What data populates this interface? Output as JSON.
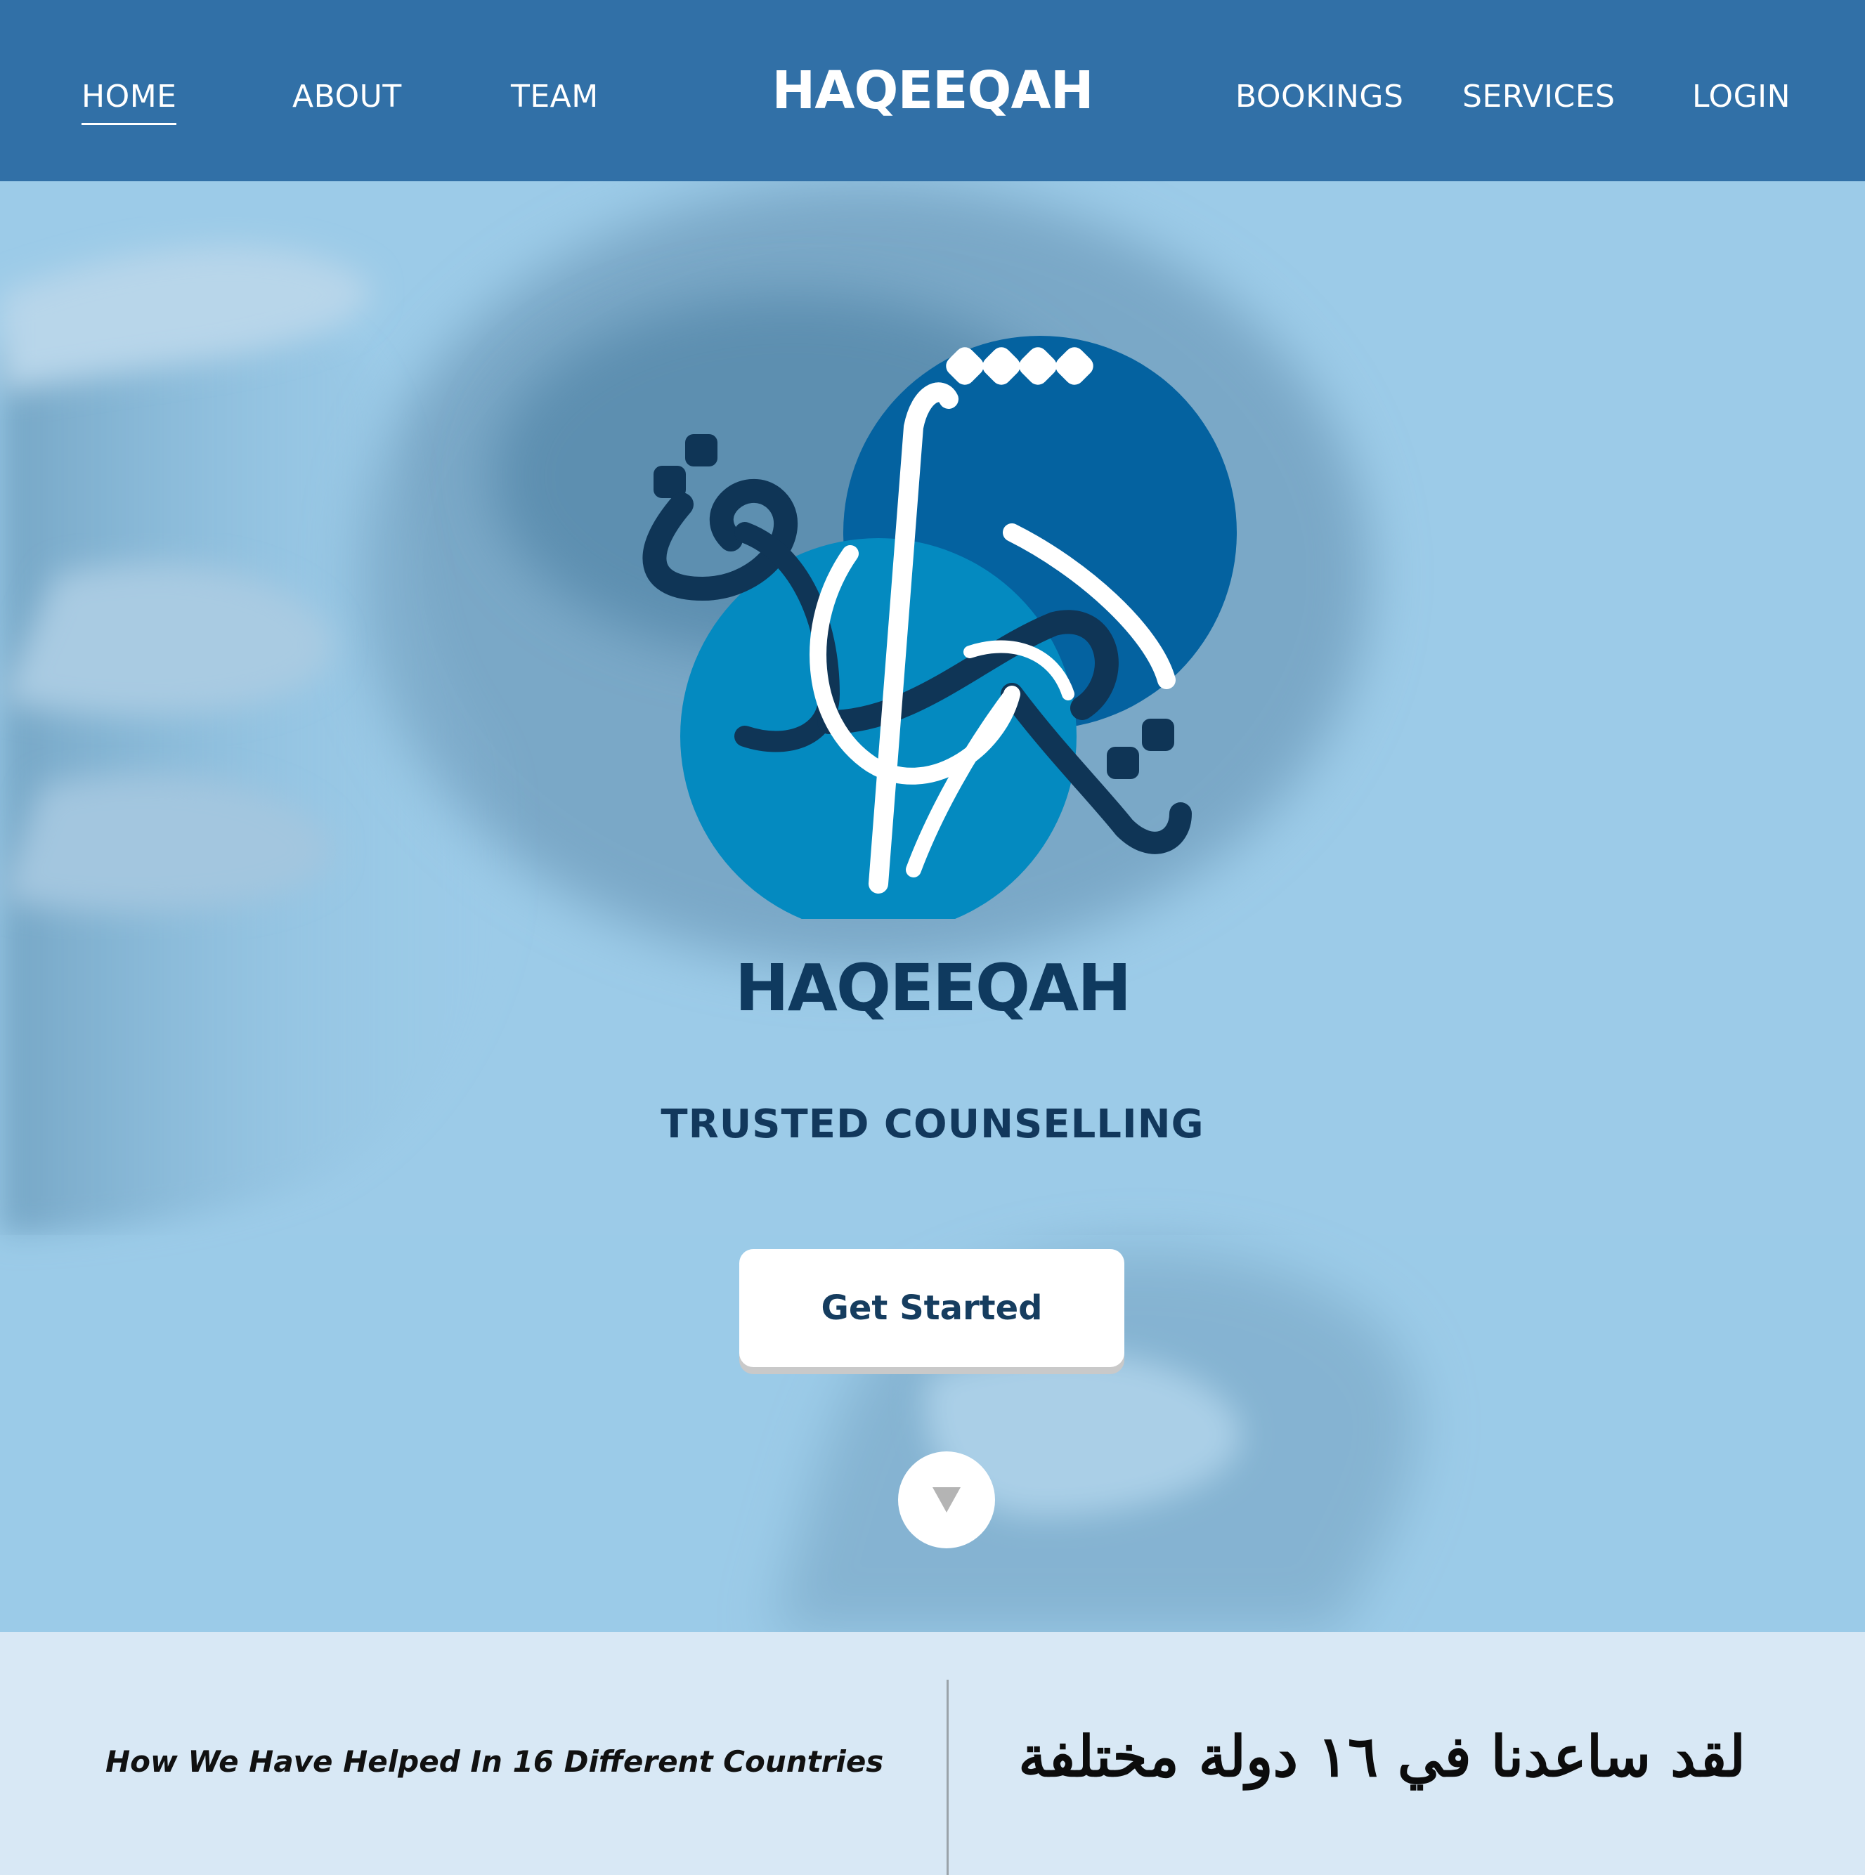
{
  "nav": {
    "left_items": [
      {
        "label": "HOME",
        "active": true
      },
      {
        "label": "ABOUT",
        "active": false
      },
      {
        "label": "TEAM",
        "active": false
      }
    ],
    "brand": "HAQEEQAH",
    "right_items": [
      {
        "label": "BOOKINGS"
      },
      {
        "label": "SERVICES"
      },
      {
        "label": "LOGIN"
      }
    ]
  },
  "hero": {
    "logo_icon": "haqeeqah-calligraphy-logo",
    "brand": "HAQEEQAH",
    "tagline": "TRUSTED COUNSELLING",
    "cta_label": "Get Started",
    "scroll_icon": "triangle-down-icon"
  },
  "strip": {
    "english": "How We Have Helped In 16 Different Countries",
    "arabic": "لقد ساعدنا في ١٦ دولة مختلفة"
  },
  "colors": {
    "nav_bg": "#3170a7",
    "hero_bg": "#98c9e6",
    "dark_navy": "#0f3a5f",
    "circle_dark": "#0462a0",
    "circle_light": "#048ac0",
    "strip_bg": "#d8e8f5"
  }
}
